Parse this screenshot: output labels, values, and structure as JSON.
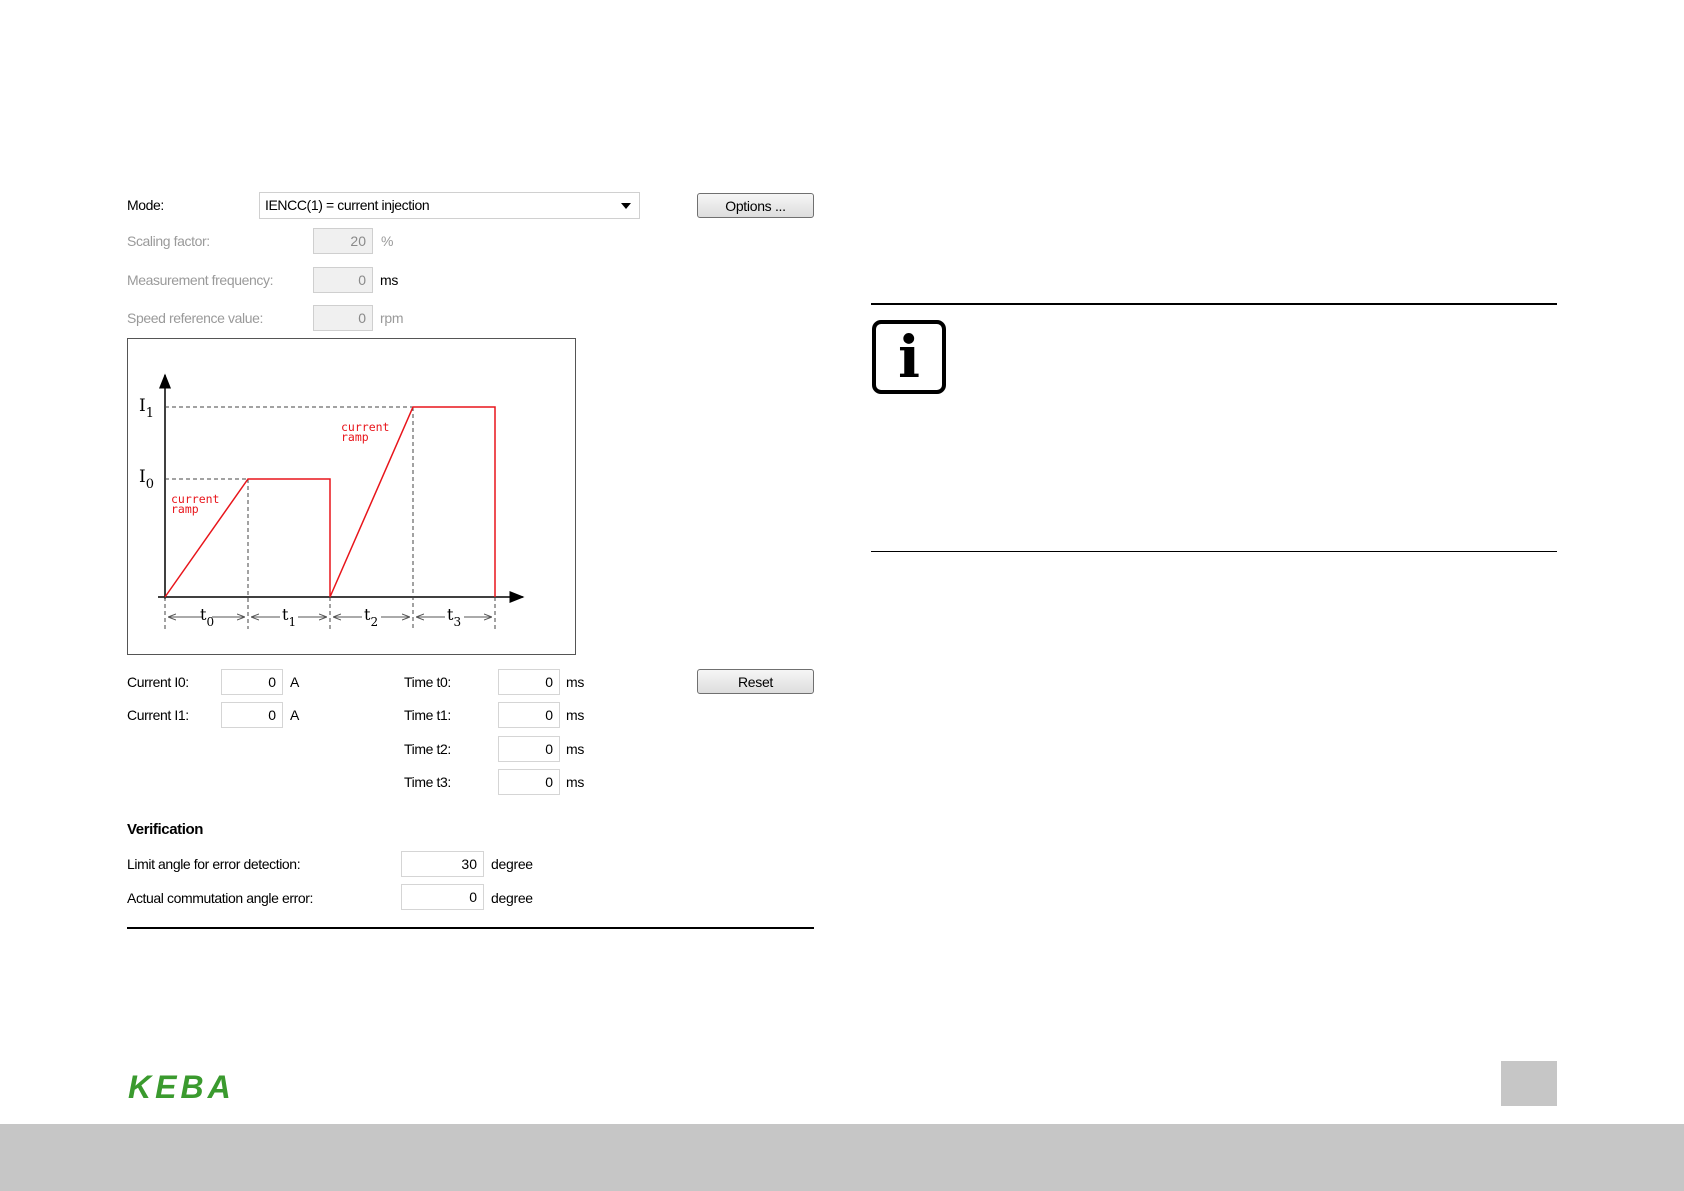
{
  "mode": {
    "label": "Mode:",
    "selected": "IENCC(1) = current injection",
    "options_button": "Options ..."
  },
  "scaling": {
    "label": "Scaling factor:",
    "value": "20",
    "unit": "%"
  },
  "measurement": {
    "label": "Measurement frequency:",
    "value": "0",
    "unit": "ms"
  },
  "speed_ref": {
    "label": "Speed reference value:",
    "value": "0",
    "unit": "rpm"
  },
  "diagram": {
    "i1": "I",
    "i1_sub": "1",
    "i0": "I",
    "i0_sub": "0",
    "ramp_word1": "current",
    "ramp_word2": "ramp",
    "t0": "t",
    "t0_sub": "0",
    "t1": "t",
    "t1_sub": "1",
    "t2": "t",
    "t2_sub": "2",
    "t3": "t",
    "t3_sub": "3",
    "curve_color": "#e8151b"
  },
  "currents": {
    "i0": {
      "label": "Current I0:",
      "value": "0",
      "unit": "A"
    },
    "i1": {
      "label": "Current I1:",
      "value": "0",
      "unit": "A"
    }
  },
  "times": {
    "t0": {
      "label": "Time t0:",
      "value": "0",
      "unit": "ms"
    },
    "t1": {
      "label": "Time t1:",
      "value": "0",
      "unit": "ms"
    },
    "t2": {
      "label": "Time t2:",
      "value": "0",
      "unit": "ms"
    },
    "t3": {
      "label": "Time t3:",
      "value": "0",
      "unit": "ms"
    }
  },
  "reset_button": "Reset",
  "verification": {
    "heading": "Verification",
    "limit": {
      "label": "Limit angle for error detection:",
      "value": "30",
      "unit": "degree"
    },
    "actual": {
      "label": "Actual commutation angle error:",
      "value": "0",
      "unit": "degree"
    }
  },
  "info_icon": {
    "icon": "info-icon",
    "glyph": "i"
  },
  "footer": {
    "logo_text": "KEBA",
    "logo_color": "#3a9a2e"
  }
}
